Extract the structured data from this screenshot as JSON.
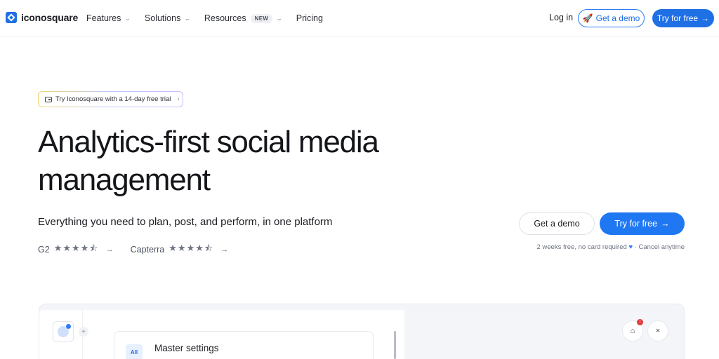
{
  "nav": {
    "logo_text": "iconosquare",
    "menu": [
      {
        "label": "Features",
        "has_dropdown": true
      },
      {
        "label": "Solutions",
        "has_dropdown": true
      },
      {
        "label": "Resources",
        "badge": "NEW",
        "has_dropdown": true
      },
      {
        "label": "Pricing",
        "has_dropdown": false
      }
    ],
    "login_label": "Log in",
    "demo_label": "Get a demo",
    "try_label": "Try for free",
    "arrow": "→",
    "rocket_icon": "rocket-icon",
    "brand_color": "#1f6fe5"
  },
  "hero": {
    "trial_chip": "Try Iconosquare with a 14-day free trial",
    "chip_arrow": "›",
    "title_line1": "Analytics-first social media",
    "title_line2": "management",
    "subtitle": "Everything you need to plan, post, and perform, in one platform",
    "ratings": [
      {
        "source": "G2",
        "stars": 4.5
      },
      {
        "source": "Capterra",
        "stars": 4.5
      }
    ],
    "rating_arrow": "→",
    "cta_demo": "Get a demo",
    "cta_try": "Try for free",
    "cta_note_1": "2 weeks free, no card required",
    "cta_note_2": "· Cancel anytime"
  },
  "preview": {
    "all_tag": "All",
    "settings_title": "Master settings",
    "plus": "+",
    "close": "×",
    "notif_count": "!"
  }
}
